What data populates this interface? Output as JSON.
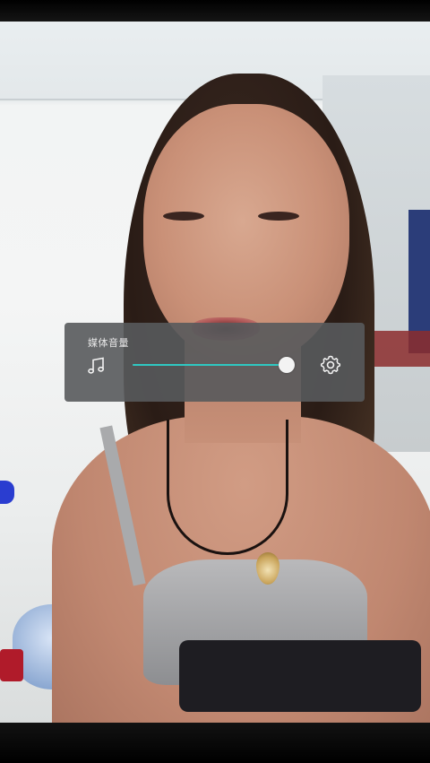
{
  "volume_panel": {
    "title": "媒体音量",
    "stream_icon": "music-note-icon",
    "settings_icon": "gear-icon",
    "level": 0.98,
    "colors": {
      "panel_bg": "#585a5c",
      "track": "#8a8c8e",
      "fill": "#2fc8c2",
      "thumb": "#f3f3f3"
    }
  }
}
